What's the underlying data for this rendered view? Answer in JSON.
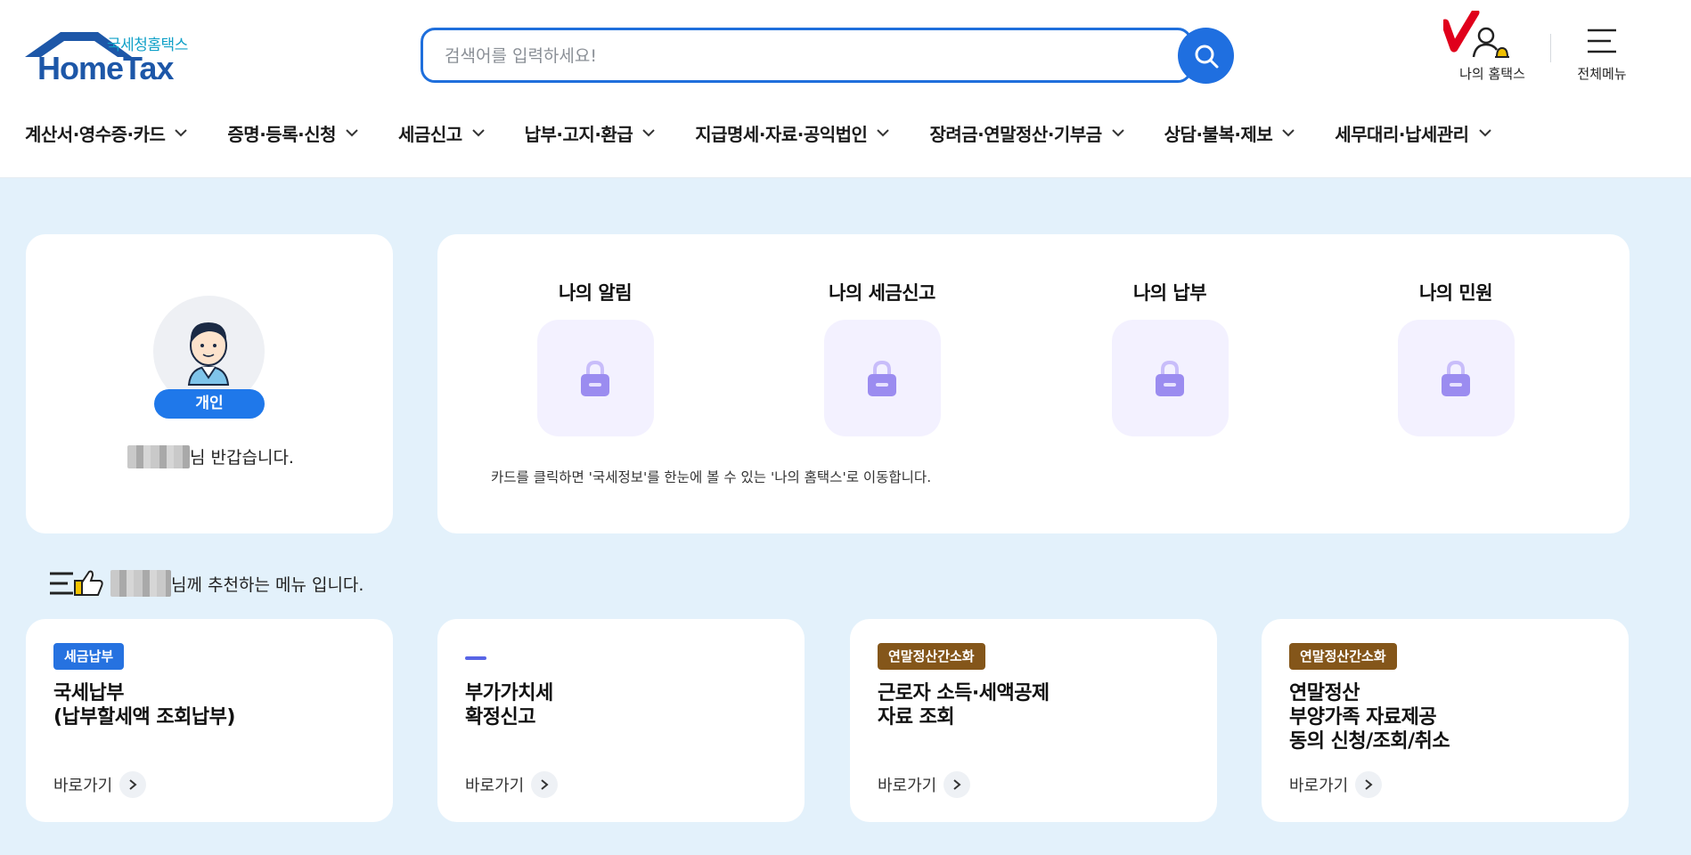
{
  "header": {
    "logo": {
      "sub": "국세청홈택스",
      "main": "HomeTax"
    },
    "search": {
      "placeholder": "검색어를 입력하세요!",
      "value": ""
    },
    "my_hometax_label": "나의 홈택스",
    "all_menu_label": "전체메뉴"
  },
  "nav": [
    "계산서·영수증·카드",
    "증명·등록·신청",
    "세금신고",
    "납부·고지·환급",
    "지급명세·자료·공익법인",
    "장려금·연말정산·기부금",
    "상담·불복·제보",
    "세무대리·납세관리"
  ],
  "profile": {
    "badge": "개인",
    "greeting_suffix": "님 반갑습니다."
  },
  "my_cards": {
    "items": [
      "나의 알림",
      "나의 세금신고",
      "나의 납부",
      "나의 민원"
    ],
    "note": "카드를 클릭하면 '국세정보'를 한눈에 볼 수 있는 '나의 홈택스'로 이동합니다."
  },
  "recommend": {
    "heading_suffix": "님께 추천하는 메뉴 입니다.",
    "go_label": "바로가기",
    "cards": [
      {
        "tag": "세금납부",
        "title": "국세납부\n(납부할세액 조회납부)"
      },
      {
        "tag": "",
        "title": "부가가치세\n확정신고"
      },
      {
        "tag": "연말정산간소화",
        "title": "근로자 소득·세액공제\n자료 조회"
      },
      {
        "tag": "연말정산간소화",
        "title": "연말정산\n부양가족 자료제공\n동의 신청/조회/취소"
      }
    ]
  },
  "colors": {
    "primary": "#1f6fe0",
    "tag_blue": "#2672e0",
    "tag_brown": "#84561a",
    "background": "#e3f1fb",
    "lock": "#9b8cf0"
  }
}
